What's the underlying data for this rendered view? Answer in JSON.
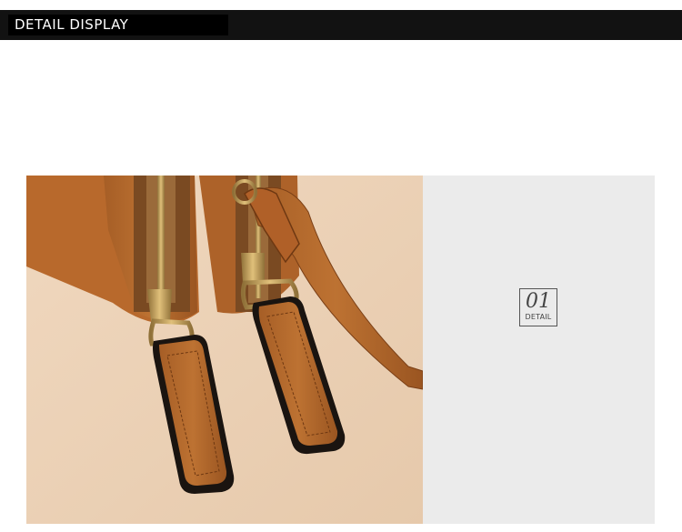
{
  "header": {
    "title": "DETAIL DISPLAY"
  },
  "detail_badge": {
    "number": "01",
    "label": "DETAIL"
  },
  "photo": {
    "subject": "tan leather wallet zipper pulls with gold zippers and wrist strap"
  },
  "colors": {
    "leather": "#b5682b",
    "leather_dark": "#8a4a1c",
    "background_beige": "#ecd4ba",
    "panel_grey": "#ebebeb",
    "header_black": "#121212",
    "zipper_gold": "#c9a25a"
  }
}
